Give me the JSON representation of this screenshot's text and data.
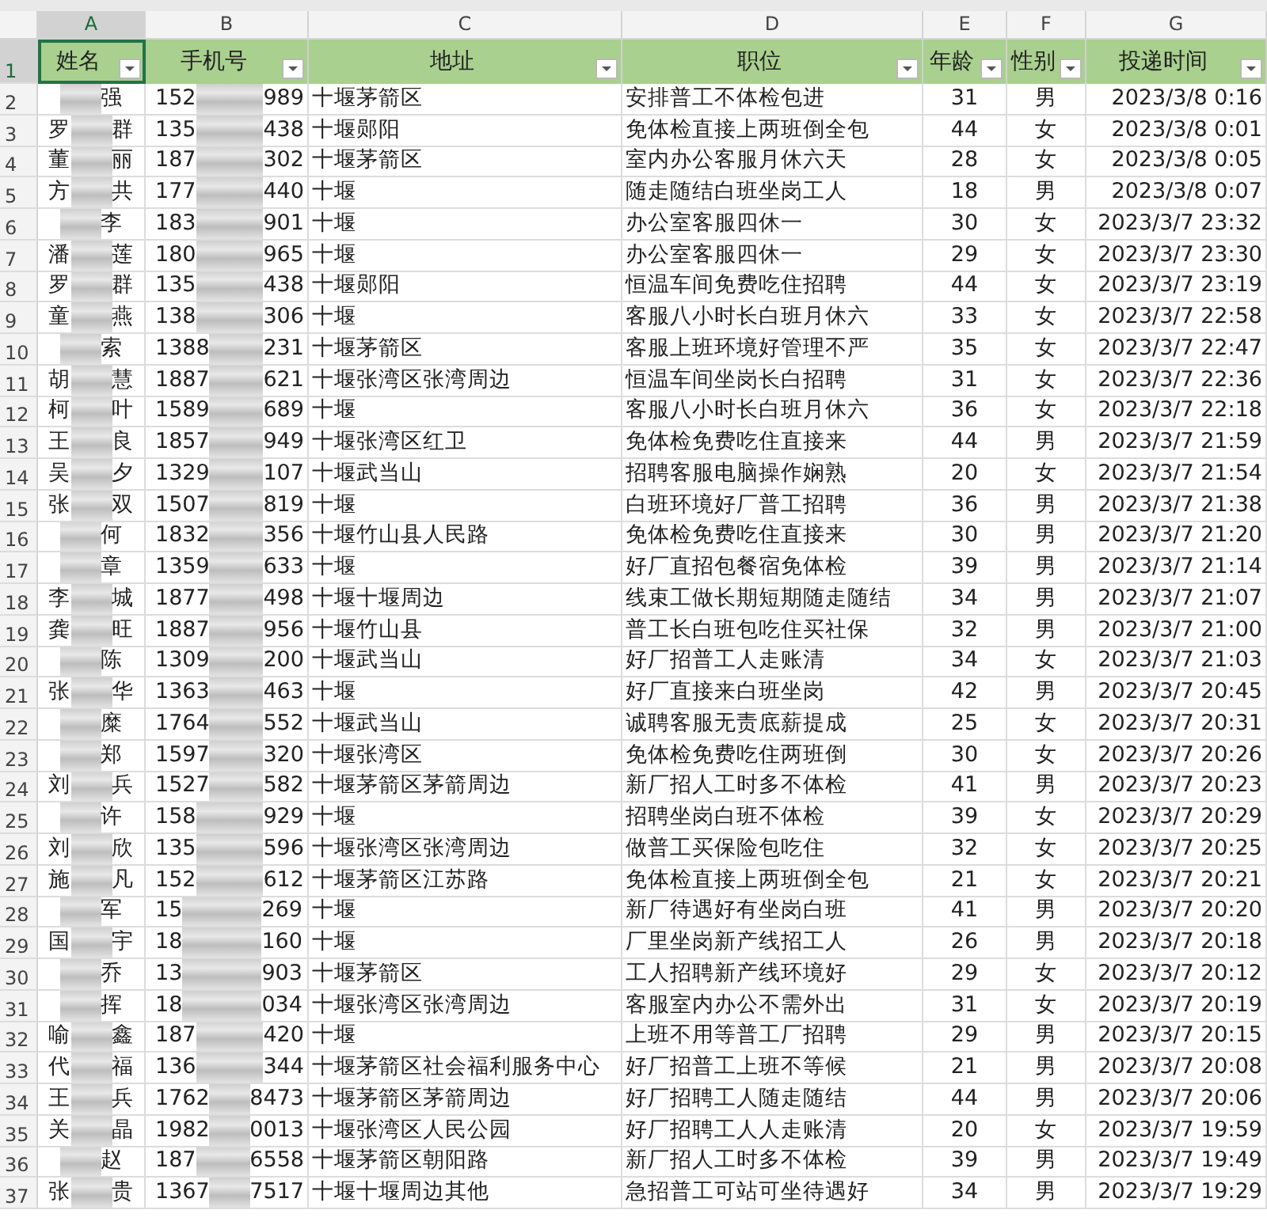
{
  "column_letters": [
    {
      "label": "A",
      "selected": true
    },
    {
      "label": "B",
      "selected": false
    },
    {
      "label": "C",
      "selected": false
    },
    {
      "label": "D",
      "selected": false
    },
    {
      "label": "E",
      "selected": false
    },
    {
      "label": "F",
      "selected": false
    },
    {
      "label": "G",
      "selected": false
    }
  ],
  "header_row": "1",
  "header": [
    {
      "label": "姓名",
      "selected": true
    },
    {
      "label": "手机号",
      "selected": false
    },
    {
      "label": "地址",
      "selected": false
    },
    {
      "label": "职位",
      "selected": false
    },
    {
      "label": "年龄",
      "selected": false
    },
    {
      "label": "性别",
      "selected": false
    },
    {
      "label": "投递时间",
      "selected": false
    }
  ],
  "rows": [
    {
      "row": "2",
      "name": [
        "强"
      ],
      "phone": [
        "152",
        "989"
      ],
      "address": "十堰茅箭区",
      "job": "安排普工不体检包进",
      "age": "31",
      "sex": "男",
      "time": "2023/3/8 0:16"
    },
    {
      "row": "3",
      "name": [
        "罗",
        "群"
      ],
      "phone": [
        "135",
        "438"
      ],
      "address": "十堰郧阳",
      "job": "免体检直接上两班倒全包",
      "age": "44",
      "sex": "女",
      "time": "2023/3/8 0:01"
    },
    {
      "row": "4",
      "name": [
        "董",
        "丽"
      ],
      "phone": [
        "187",
        "302"
      ],
      "address": "十堰茅箭区",
      "job": "室内办公客服月休六天",
      "age": "28",
      "sex": "女",
      "time": "2023/3/8 0:05"
    },
    {
      "row": "5",
      "name": [
        "方",
        "共"
      ],
      "phone": [
        "177",
        "440"
      ],
      "address": "十堰",
      "job": "随走随结白班坐岗工人",
      "age": "18",
      "sex": "男",
      "time": "2023/3/8 0:07"
    },
    {
      "row": "6",
      "name": [
        "李"
      ],
      "phone": [
        "183",
        "901"
      ],
      "address": "十堰",
      "job": "办公室客服四休一",
      "age": "30",
      "sex": "女",
      "time": "2023/3/7 23:32"
    },
    {
      "row": "7",
      "name": [
        "潘",
        "莲"
      ],
      "phone": [
        "180",
        "965"
      ],
      "address": "十堰",
      "job": "办公室客服四休一",
      "age": "29",
      "sex": "女",
      "time": "2023/3/7 23:30"
    },
    {
      "row": "8",
      "name": [
        "罗",
        "群"
      ],
      "phone": [
        "135",
        "438"
      ],
      "address": "十堰郧阳",
      "job": "恒温车间免费吃住招聘",
      "age": "44",
      "sex": "女",
      "time": "2023/3/7 23:19"
    },
    {
      "row": "9",
      "name": [
        "童",
        "燕"
      ],
      "phone": [
        "138",
        "306"
      ],
      "address": "十堰",
      "job": "客服八小时长白班月休六",
      "age": "33",
      "sex": "女",
      "time": "2023/3/7 22:58"
    },
    {
      "row": "10",
      "name": [
        "索"
      ],
      "phone": [
        "1388",
        "231"
      ],
      "address": "十堰茅箭区",
      "job": "客服上班环境好管理不严",
      "age": "35",
      "sex": "女",
      "time": "2023/3/7 22:47"
    },
    {
      "row": "11",
      "name": [
        "胡",
        "慧"
      ],
      "phone": [
        "1887",
        "621"
      ],
      "address": "十堰张湾区张湾周边",
      "job": "恒温车间坐岗长白招聘",
      "age": "31",
      "sex": "女",
      "time": "2023/3/7 22:36"
    },
    {
      "row": "12",
      "name": [
        "柯",
        "叶"
      ],
      "phone": [
        "1589",
        "689"
      ],
      "address": "十堰",
      "job": "客服八小时长白班月休六",
      "age": "36",
      "sex": "女",
      "time": "2023/3/7 22:18"
    },
    {
      "row": "13",
      "name": [
        "王",
        "良"
      ],
      "phone": [
        "1857",
        "949"
      ],
      "address": "十堰张湾区红卫",
      "job": "免体检免费吃住直接来",
      "age": "44",
      "sex": "男",
      "time": "2023/3/7 21:59"
    },
    {
      "row": "14",
      "name": [
        "吴",
        "夕"
      ],
      "phone": [
        "1329",
        "107"
      ],
      "address": "十堰武当山",
      "job": "招聘客服电脑操作娴熟",
      "age": "20",
      "sex": "女",
      "time": "2023/3/7 21:54"
    },
    {
      "row": "15",
      "name": [
        "张",
        "双"
      ],
      "phone": [
        "1507",
        "819"
      ],
      "address": "十堰",
      "job": "白班环境好厂普工招聘",
      "age": "36",
      "sex": "男",
      "time": "2023/3/7 21:38"
    },
    {
      "row": "16",
      "name": [
        "何"
      ],
      "phone": [
        "1832",
        "356"
      ],
      "address": "十堰竹山县人民路",
      "job": "免体检免费吃住直接来",
      "age": "30",
      "sex": "男",
      "time": "2023/3/7 21:20"
    },
    {
      "row": "17",
      "name": [
        "章"
      ],
      "phone": [
        "1359",
        "633"
      ],
      "address": "十堰",
      "job": "好厂直招包餐宿免体检",
      "age": "39",
      "sex": "男",
      "time": "2023/3/7 21:14"
    },
    {
      "row": "18",
      "name": [
        "李",
        "城"
      ],
      "phone": [
        "1877",
        "498"
      ],
      "address": "十堰十堰周边",
      "job": "线束工做长期短期随走随结",
      "age": "34",
      "sex": "男",
      "time": "2023/3/7 21:07"
    },
    {
      "row": "19",
      "name": [
        "龚",
        "旺"
      ],
      "phone": [
        "1887",
        "956"
      ],
      "address": "十堰竹山县",
      "job": "普工长白班包吃住买社保",
      "age": "32",
      "sex": "男",
      "time": "2023/3/7 21:00"
    },
    {
      "row": "20",
      "name": [
        "陈"
      ],
      "phone": [
        "1309",
        "200"
      ],
      "address": "十堰武当山",
      "job": "好厂招普工人走账清",
      "age": "34",
      "sex": "女",
      "time": "2023/3/7 21:03"
    },
    {
      "row": "21",
      "name": [
        "张",
        "华"
      ],
      "phone": [
        "1363",
        "463"
      ],
      "address": "十堰",
      "job": "好厂直接来白班坐岗",
      "age": "42",
      "sex": "男",
      "time": "2023/3/7 20:45"
    },
    {
      "row": "22",
      "name": [
        "糜"
      ],
      "phone": [
        "1764",
        "552"
      ],
      "address": "十堰武当山",
      "job": "诚聘客服无责底薪提成",
      "age": "25",
      "sex": "女",
      "time": "2023/3/7 20:31"
    },
    {
      "row": "23",
      "name": [
        "郑"
      ],
      "phone": [
        "1597",
        "320"
      ],
      "address": "十堰张湾区",
      "job": "免体检免费吃住两班倒",
      "age": "30",
      "sex": "女",
      "time": "2023/3/7 20:26"
    },
    {
      "row": "24",
      "name": [
        "刘",
        "兵"
      ],
      "phone": [
        "1527",
        "582"
      ],
      "address": "十堰茅箭区茅箭周边",
      "job": "新厂招人工时多不体检",
      "age": "41",
      "sex": "男",
      "time": "2023/3/7 20:23"
    },
    {
      "row": "25",
      "name": [
        "许"
      ],
      "phone": [
        "158",
        "929"
      ],
      "address": "十堰",
      "job": "招聘坐岗白班不体检",
      "age": "39",
      "sex": "女",
      "time": "2023/3/7 20:29"
    },
    {
      "row": "26",
      "name": [
        "刘",
        "欣"
      ],
      "phone": [
        "135",
        "596"
      ],
      "address": "十堰张湾区张湾周边",
      "job": "做普工买保险包吃住",
      "age": "32",
      "sex": "女",
      "time": "2023/3/7 20:25"
    },
    {
      "row": "27",
      "name": [
        "施",
        "凡"
      ],
      "phone": [
        "152",
        "612"
      ],
      "address": "十堰茅箭区江苏路",
      "job": "免体检直接上两班倒全包",
      "age": "21",
      "sex": "女",
      "time": "2023/3/7 20:21"
    },
    {
      "row": "28",
      "name": [
        "军"
      ],
      "phone": [
        "15",
        "269"
      ],
      "address": "十堰",
      "job": "新厂待遇好有坐岗白班",
      "age": "41",
      "sex": "男",
      "time": "2023/3/7 20:20"
    },
    {
      "row": "29",
      "name": [
        "国",
        "宇"
      ],
      "phone": [
        "18",
        "160"
      ],
      "address": "十堰",
      "job": "厂里坐岗新产线招工人",
      "age": "26",
      "sex": "男",
      "time": "2023/3/7 20:18"
    },
    {
      "row": "30",
      "name": [
        "乔"
      ],
      "phone": [
        "13",
        "903"
      ],
      "address": "十堰茅箭区",
      "job": "工人招聘新产线环境好",
      "age": "29",
      "sex": "女",
      "time": "2023/3/7 20:12"
    },
    {
      "row": "31",
      "name": [
        "挥"
      ],
      "phone": [
        "18",
        "034"
      ],
      "address": "十堰张湾区张湾周边",
      "job": "客服室内办公不需外出",
      "age": "31",
      "sex": "女",
      "time": "2023/3/7 20:19"
    },
    {
      "row": "32",
      "name": [
        "喻",
        "鑫"
      ],
      "phone": [
        "187",
        "420"
      ],
      "address": "十堰",
      "job": "上班不用等普工厂招聘",
      "age": "29",
      "sex": "男",
      "time": "2023/3/7 20:15"
    },
    {
      "row": "33",
      "name": [
        "代",
        "福"
      ],
      "phone": [
        "136",
        "344"
      ],
      "address": "十堰茅箭区社会福利服务中心",
      "job": "好厂招普工上班不等候",
      "age": "21",
      "sex": "男",
      "time": "2023/3/7 20:08"
    },
    {
      "row": "34",
      "name": [
        "王",
        "兵"
      ],
      "phone": [
        "1762",
        "8473"
      ],
      "address": "十堰茅箭区茅箭周边",
      "job": "好厂招聘工人随走随结",
      "age": "44",
      "sex": "男",
      "time": "2023/3/7 20:06"
    },
    {
      "row": "35",
      "name": [
        "关",
        "晶"
      ],
      "phone": [
        "1982",
        "0013"
      ],
      "address": "十堰张湾区人民公园",
      "job": "好厂招聘工人人走账清",
      "age": "20",
      "sex": "女",
      "time": "2023/3/7 19:59"
    },
    {
      "row": "36",
      "name": [
        "赵"
      ],
      "phone": [
        "187",
        "6558"
      ],
      "address": "十堰茅箭区朝阳路",
      "job": "新厂招人工时多不体检",
      "age": "39",
      "sex": "男",
      "time": "2023/3/7 19:49"
    },
    {
      "row": "37",
      "name": [
        "张",
        "贵"
      ],
      "phone": [
        "1367",
        "7517"
      ],
      "address": "十堰十堰周边其他",
      "job": "急招普工可站可坐待遇好",
      "age": "34",
      "sex": "男",
      "time": "2023/3/7 19:29"
    }
  ]
}
